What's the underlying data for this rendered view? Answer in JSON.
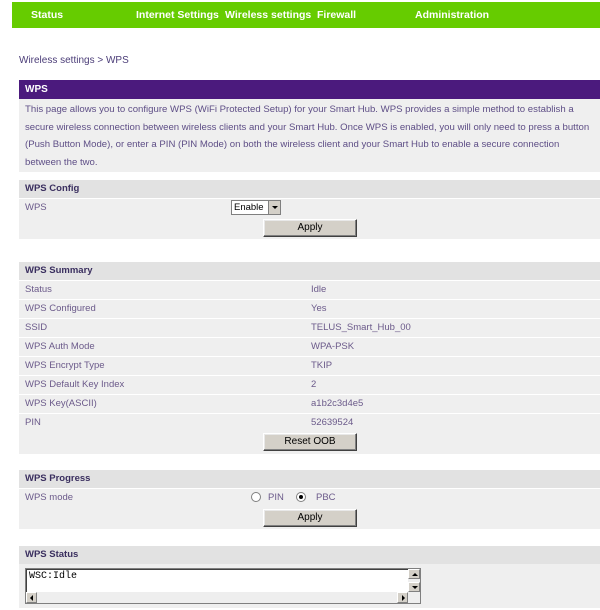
{
  "nav": {
    "items": [
      "Status",
      "Internet Settings",
      "Wireless settings",
      "Firewall",
      "Administration"
    ],
    "color": "#66cc00"
  },
  "breadcrumb": "Wireless settings > WPS",
  "wps_header": {
    "title": "WPS",
    "description": "This page allows you to configure WPS (WiFi Protected Setup) for your Smart Hub. WPS provides a simple method to establish a secure wireless connection between wireless clients and your Smart Hub. Once WPS is enabled, you will only need to press a button (Push Button Mode), or enter a PIN (PIN Mode) on both the wireless client and your Smart Hub to enable a secure connection between the two.",
    "color": "#4b1a7d"
  },
  "config": {
    "title": "WPS Config",
    "wps_label": "WPS",
    "wps_value": "Enable",
    "apply_label": "Apply"
  },
  "summary": {
    "title": "WPS Summary",
    "rows": [
      {
        "label": "Status",
        "value": "Idle"
      },
      {
        "label": "WPS Configured",
        "value": "Yes"
      },
      {
        "label": "SSID",
        "value": "TELUS_Smart_Hub_00"
      },
      {
        "label": "WPS Auth Mode",
        "value": "WPA-PSK"
      },
      {
        "label": "WPS Encrypt Type",
        "value": "TKIP"
      },
      {
        "label": "WPS Default Key Index",
        "value": "2"
      },
      {
        "label": "WPS Key(ASCII)",
        "value": "a1b2c3d4e5"
      },
      {
        "label": "PIN",
        "value": "52639524"
      }
    ],
    "reset_label": "Reset OOB"
  },
  "progress": {
    "title": "WPS Progress",
    "mode_label": "WPS mode",
    "pin_label": "PIN",
    "pbc_label": "PBC",
    "selected": "PBC",
    "apply_label": "Apply"
  },
  "status": {
    "title": "WPS Status",
    "text": "WSC:Idle"
  }
}
